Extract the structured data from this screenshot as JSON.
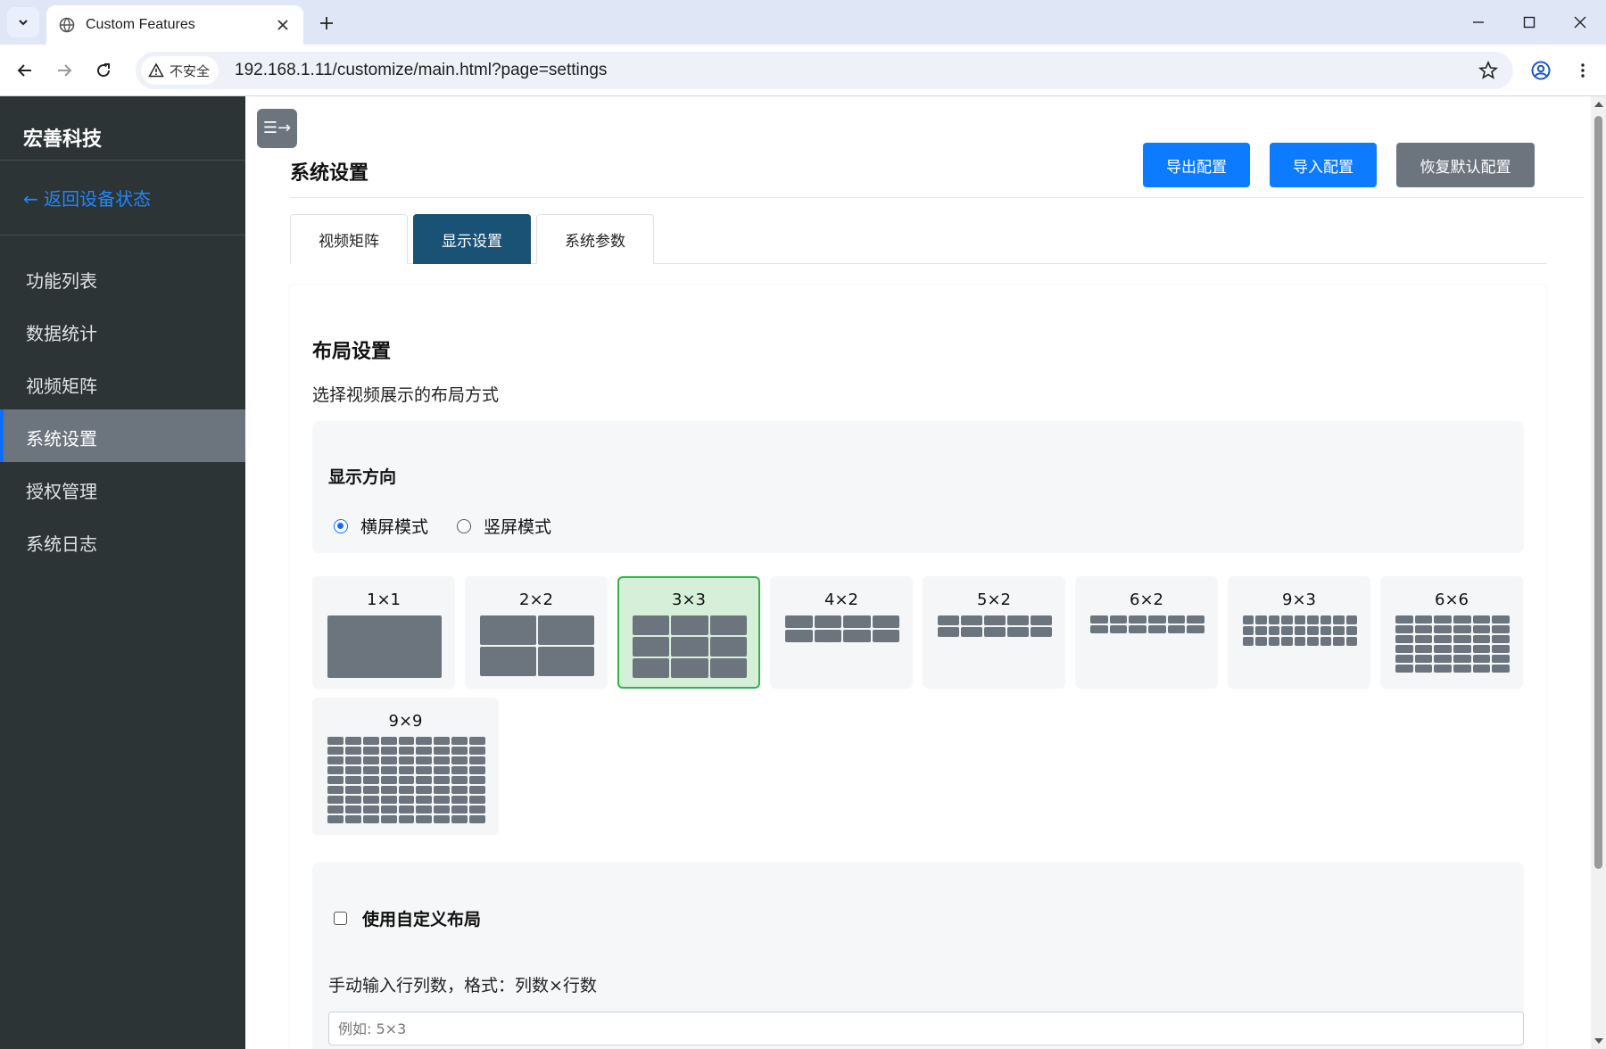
{
  "browser": {
    "tab_title": "Custom Features",
    "security_label": "不安全",
    "url": "192.168.1.11/customize/main.html?page=settings"
  },
  "sidebar": {
    "brand": "宏善科技",
    "back_link": "← 返回设备状态",
    "items": [
      {
        "label": "功能列表",
        "active": false
      },
      {
        "label": "数据统计",
        "active": false
      },
      {
        "label": "视频矩阵",
        "active": false
      },
      {
        "label": "系统设置",
        "active": true
      },
      {
        "label": "授权管理",
        "active": false
      },
      {
        "label": "系统日志",
        "active": false
      }
    ]
  },
  "main": {
    "toggle_icon": "☰→",
    "page_title": "系统设置",
    "buttons": {
      "export": "导出配置",
      "import": "导入配置",
      "restore": "恢复默认配置"
    },
    "tabs": [
      {
        "label": "视频矩阵",
        "active": false
      },
      {
        "label": "显示设置",
        "active": true
      },
      {
        "label": "系统参数",
        "active": false
      }
    ],
    "layout": {
      "title": "布局设置",
      "desc": "选择视频展示的布局方式",
      "orientation_title": "显示方向",
      "orientation_options": [
        {
          "label": "横屏模式",
          "checked": true
        },
        {
          "label": "竖屏模式",
          "checked": false
        }
      ],
      "options": [
        {
          "label": "1×1",
          "cols": 1,
          "rows": 1,
          "selected": false
        },
        {
          "label": "2×2",
          "cols": 2,
          "rows": 2,
          "selected": false
        },
        {
          "label": "3×3",
          "cols": 3,
          "rows": 3,
          "selected": true
        },
        {
          "label": "4×2",
          "cols": 4,
          "rows": 2,
          "selected": false
        },
        {
          "label": "5×2",
          "cols": 5,
          "rows": 2,
          "selected": false
        },
        {
          "label": "6×2",
          "cols": 6,
          "rows": 2,
          "selected": false
        },
        {
          "label": "9×3",
          "cols": 9,
          "rows": 3,
          "selected": false
        },
        {
          "label": "6×6",
          "cols": 6,
          "rows": 6,
          "selected": false
        },
        {
          "label": "9×9",
          "cols": 9,
          "rows": 9,
          "selected": false
        }
      ],
      "custom_label": "使用自定义布局",
      "custom_hint": "手动输入行列数，格式：列数×行数",
      "custom_placeholder": "例如: 5×3"
    }
  },
  "colors": {
    "sidebar_bg": "#2c3436",
    "primary": "#0d7bff",
    "active_tab": "#1a5276",
    "selected_layout": "#2fb34a"
  }
}
